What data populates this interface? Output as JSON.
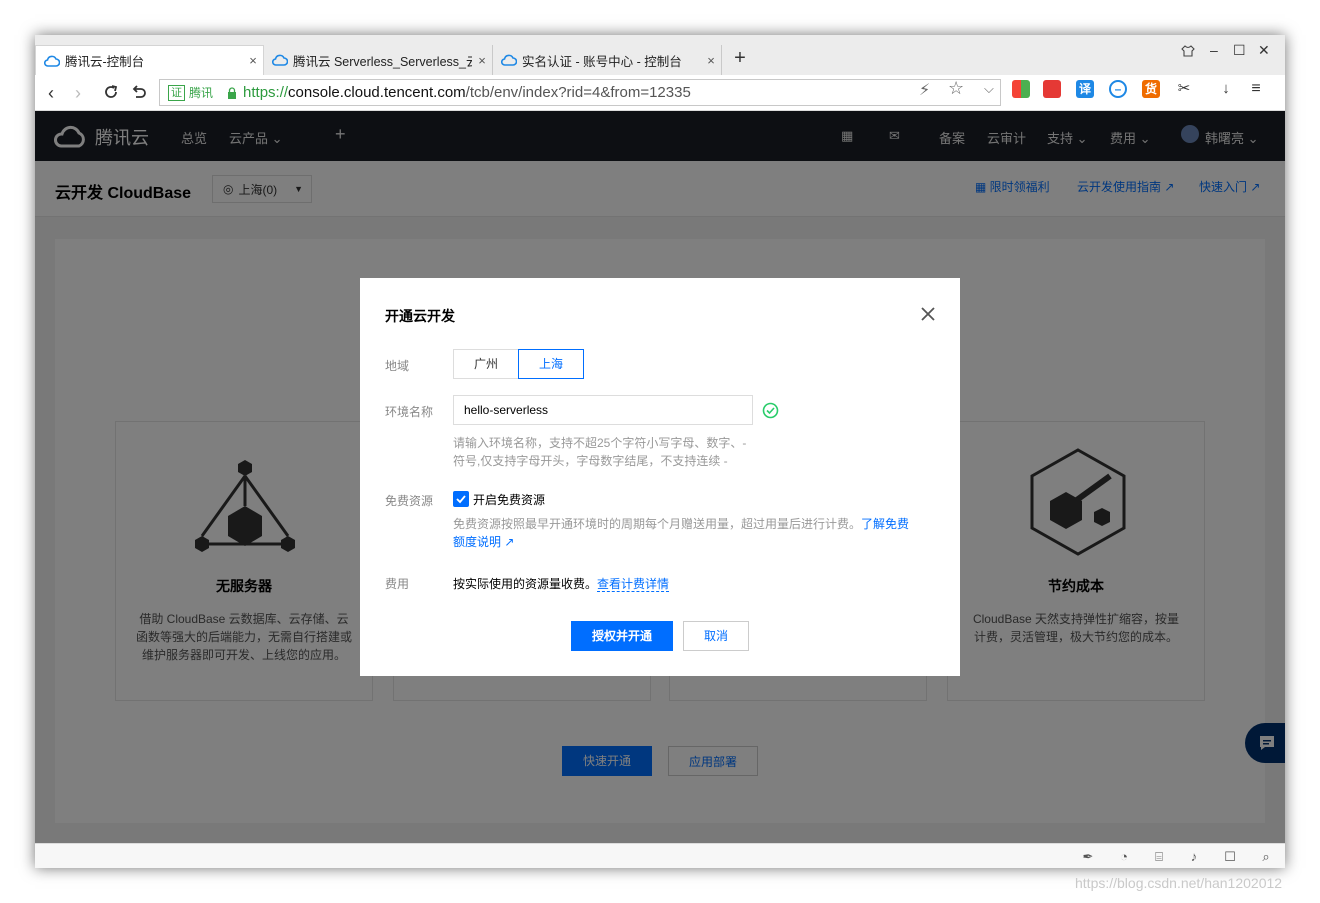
{
  "browser": {
    "tabs": [
      {
        "label": "腾讯云-控制台",
        "close": "×"
      },
      {
        "label": "腾讯云 Serverless_Serverless_云",
        "close": "×"
      },
      {
        "label": "实名认证 - 账号中心 - 控制台",
        "close": "×"
      }
    ],
    "new_tab": "+",
    "window_controls": {
      "min": "–",
      "max": "☐",
      "close": "✕"
    },
    "cert_badge": "证",
    "cert_org": "腾讯",
    "url_scheme": "https://",
    "url_host": "console.cloud.tencent.com",
    "url_path": "/tcb/env/index?rid=4&from=12335"
  },
  "topnav": {
    "brand": "腾讯云",
    "items": [
      "总览",
      "云产品 ⌄",
      "+"
    ],
    "right_items": [
      "备案",
      "云审计",
      "支持 ⌄",
      "费用 ⌄",
      "韩曙亮 ⌄"
    ]
  },
  "subheader": {
    "title": "云开发 CloudBase",
    "region": "上海(0)",
    "links": [
      "限时领福利",
      "云开发使用指南",
      "快速入门"
    ]
  },
  "features": [
    {
      "title": "无服务器",
      "desc": "借助 CloudBase 云数据库、云存储、云函数等强大的后端能力，无需自行搭建或维护服务器即可开发、上线您的应用。"
    },
    {
      "title": "节约成本",
      "desc": "CloudBase 天然支持弹性扩缩容，按量计费，灵活管理，极大节约您的成本。"
    }
  ],
  "cta": {
    "quick_open": "快速开通",
    "deploy": "应用部署"
  },
  "dialog": {
    "title": "开通云开发",
    "region_label": "地域",
    "region_options": [
      "广州",
      "上海"
    ],
    "selected_region": "上海",
    "env_label": "环境名称",
    "env_value": "hello-serverless",
    "env_help_1": "请输入环境名称，支持不超25个字符小写字母、数字、-",
    "env_help_2": "符号,仅支持字母开头，字母数字结尾，不支持连续 -",
    "free_label": "免费资源",
    "free_checkbox": "开启免费资源",
    "free_help_1": "免费资源按照最早开通环境时的周期每个月赠送用量，超过用量后进行计费。",
    "free_help_link_1": "了解免费",
    "free_help_link_2": "额度说明",
    "fee_label": "费用",
    "fee_text": "按实际使用的资源量收费。",
    "fee_link": "查看计费详情",
    "ok": "授权并开通",
    "cancel": "取消"
  },
  "watermark": "https://blog.csdn.net/han1202012",
  "colors": {
    "primary": "#006eff",
    "nav_bg": "#1b1f26",
    "success": "#29cc6a"
  }
}
